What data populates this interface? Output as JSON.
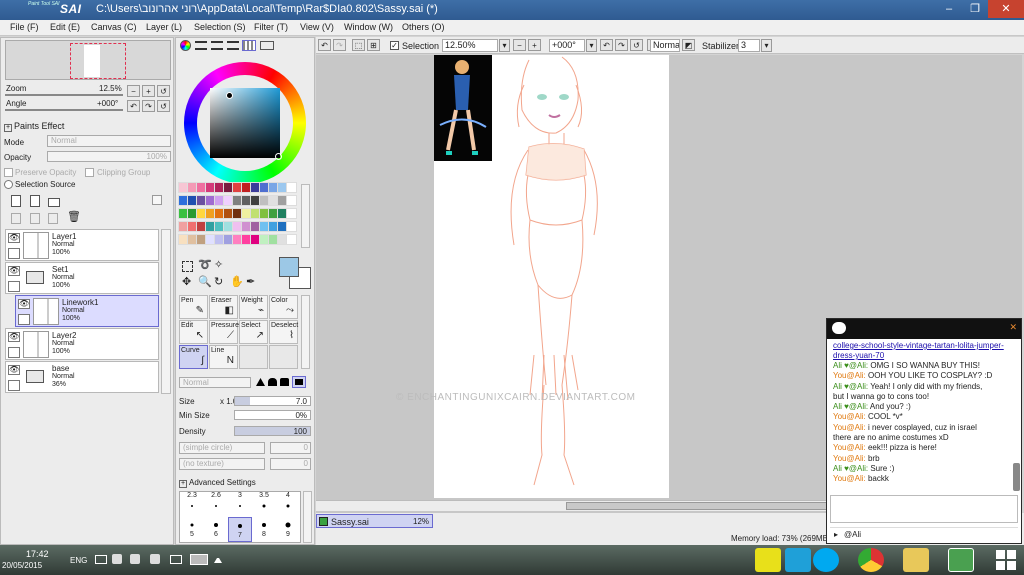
{
  "window": {
    "app_logo": "Paint Tool SAI",
    "app_logo_short": "SAI",
    "title": "C:\\Users\\רוני אהרונוב\\AppData\\Local\\Temp\\Rar$DIa0.802\\Sassy.sai (*)",
    "min": "–",
    "max": "❐",
    "close": "✕"
  },
  "menu": [
    "File (F)",
    "Edit (E)",
    "Canvas (C)",
    "Layer (L)",
    "Selection (S)",
    "Filter (T)",
    "View (V)",
    "Window (W)",
    "Others (O)"
  ],
  "navigator": {
    "zoom_label": "Zoom",
    "zoom_value": "12.5%",
    "angle_label": "Angle",
    "angle_value": "+000°"
  },
  "paints_effect": {
    "header": "Paints Effect",
    "mode_label": "Mode",
    "mode_value": "Normal",
    "opacity_label": "Opacity",
    "opacity_value": "100%",
    "preserve_opacity": "Preserve Opacity",
    "clipping_group": "Clipping Group",
    "selection_source": "Selection Source"
  },
  "layers": [
    {
      "name": "Layer1",
      "mode": "Normal",
      "opacity": "100%",
      "kind": "layer"
    },
    {
      "name": "Set1",
      "mode": "Normal",
      "opacity": "100%",
      "kind": "folder"
    },
    {
      "name": "Linework1",
      "mode": "Normal",
      "opacity": "100%",
      "kind": "linework"
    },
    {
      "name": "Layer2",
      "mode": "Normal",
      "opacity": "100%",
      "kind": "layer"
    },
    {
      "name": "base",
      "mode": "Normal",
      "opacity": "36%",
      "kind": "folder"
    }
  ],
  "swatches": [
    "#f7c6d4",
    "#f49ab6",
    "#ef6fa0",
    "#d43a7a",
    "#b0225a",
    "#7a1a40",
    "#e04040",
    "#c02020",
    "#3b3b9a",
    "#4e6fd0",
    "#79a6e6",
    "#9cc8ef",
    "#fff",
    "#2d6fdc",
    "#1f4fb0",
    "#6b4fa0",
    "#a06bd0",
    "#d0a0f0",
    "#f0d0ff",
    "#808080",
    "#606060",
    "#404040",
    "#bfbfbf",
    "#e0e0e0",
    "#a0a0a0",
    "#fff",
    "#3ac040",
    "#2a9a30",
    "#ffd740",
    "#f0a020",
    "#e07010",
    "#b05010",
    "#703010",
    "#f0f0a0",
    "#c0e070",
    "#80c040",
    "#40a040",
    "#208060",
    "#fff",
    "#f0a0a0",
    "#f07070",
    "#c04040",
    "#30a0a0",
    "#50c0c0",
    "#a0e0e0",
    "#f0c0f0",
    "#d090d0",
    "#a060a0",
    "#70c0f0",
    "#40a0e0",
    "#1f70c0",
    "#fff",
    "#f8e0c0",
    "#e0c0a0",
    "#c0a080",
    "#e0e0ff",
    "#c0c0f0",
    "#a0a0e0",
    "#ff80c0",
    "#ff40a0",
    "#e00080",
    "#c0f0c0",
    "#a0e0a0",
    "#e0e0e0",
    "#fff"
  ],
  "tools": {
    "row1": [
      {
        "name": "Pen",
        "icon": "✎"
      },
      {
        "name": "Eraser",
        "icon": "◧"
      },
      {
        "name": "Weight",
        "icon": "⌁"
      },
      {
        "name": "Color",
        "icon": "⤳"
      }
    ],
    "row2": [
      {
        "name": "Edit",
        "icon": "↖"
      },
      {
        "name": "Pressure",
        "icon": "⟋"
      },
      {
        "name": "Select",
        "icon": "↗"
      },
      {
        "name": "Deselect",
        "icon": "⌇"
      }
    ],
    "row3": [
      {
        "name": "Curve",
        "icon": "∫"
      },
      {
        "name": "Line",
        "icon": "N"
      }
    ]
  },
  "brush": {
    "mode_value": "Normal",
    "size_label": "Size",
    "size_mult": "x 1.0",
    "size_value": "7.0",
    "minsize_label": "Min Size",
    "minsize_value": "0%",
    "density_label": "Density",
    "density_value": "100",
    "shape_placeholder": "(simple circle)",
    "shape_value": "0",
    "texture_placeholder": "(no texture)",
    "texture_value": "0",
    "advanced": "Advanced Settings",
    "sizes_top": [
      "2.3",
      "2.6",
      "3",
      "3.5",
      "4"
    ],
    "sizes_bottom": [
      "5",
      "6",
      "7",
      "8",
      "9"
    ]
  },
  "canvas_toolbar": {
    "selection_label": "Selection",
    "zoom": "12.50%",
    "angle": "+000°",
    "blend": "Normal",
    "stabilizer_label": "Stabilizer",
    "stabilizer_value": "3"
  },
  "watermark": "© ENCHANTINGUNIXCAIRN.DEVIANTART.COM",
  "doc_tab": {
    "name": "Sassy.sai",
    "zoom": "12%"
  },
  "status": {
    "memory": "Memory load: 73% (269MB"
  },
  "chat": {
    "link": "college-school-style-vintage-tartan-lolita-jumper-dress-yuan-70",
    "messages": [
      {
        "who": "Ali ♥@Ali:",
        "text": "OMG I SO WANNA BUY THIS!",
        "cls": "ali"
      },
      {
        "who": "You@Ali:",
        "text": "OOH YOU LIKE TO COSPLAY? :D",
        "cls": "you"
      },
      {
        "who": "Ali ♥@Ali:",
        "text": "Yeah! I only did with my friends,",
        "cls": "ali"
      },
      {
        "who": "",
        "text": "but I wanna go to cons too!",
        "cls": "cont"
      },
      {
        "who": "Ali ♥@Ali:",
        "text": "And you? :)",
        "cls": "ali"
      },
      {
        "who": "You@Ali:",
        "text": "COOL *v*",
        "cls": "you"
      },
      {
        "who": "You@Ali:",
        "text": "i never cosplayed, cuz in israel",
        "cls": "you"
      },
      {
        "who": "",
        "text": "there are no anime costumes xD",
        "cls": "cont"
      },
      {
        "who": "You@Ali:",
        "text": "eek!!! pizza is here!",
        "cls": "you"
      },
      {
        "who": "You@Ali:",
        "text": "brb",
        "cls": "you"
      },
      {
        "who": "Ali ♥@Ali:",
        "text": "Sure :)",
        "cls": "ali"
      },
      {
        "who": "You@Ali:",
        "text": "backk",
        "cls": "you"
      }
    ],
    "recipient": "@Ali",
    "close": "✕"
  },
  "taskbar": {
    "time": "17:42",
    "date": "20/05/2015",
    "lang": "ENG"
  },
  "colors": {
    "titlebar": "#3e6fa7",
    "selected_layer": "#dcdcff",
    "ali_name": "#3a8e19",
    "you_name": "#e07a10",
    "link": "#1a0dab"
  }
}
